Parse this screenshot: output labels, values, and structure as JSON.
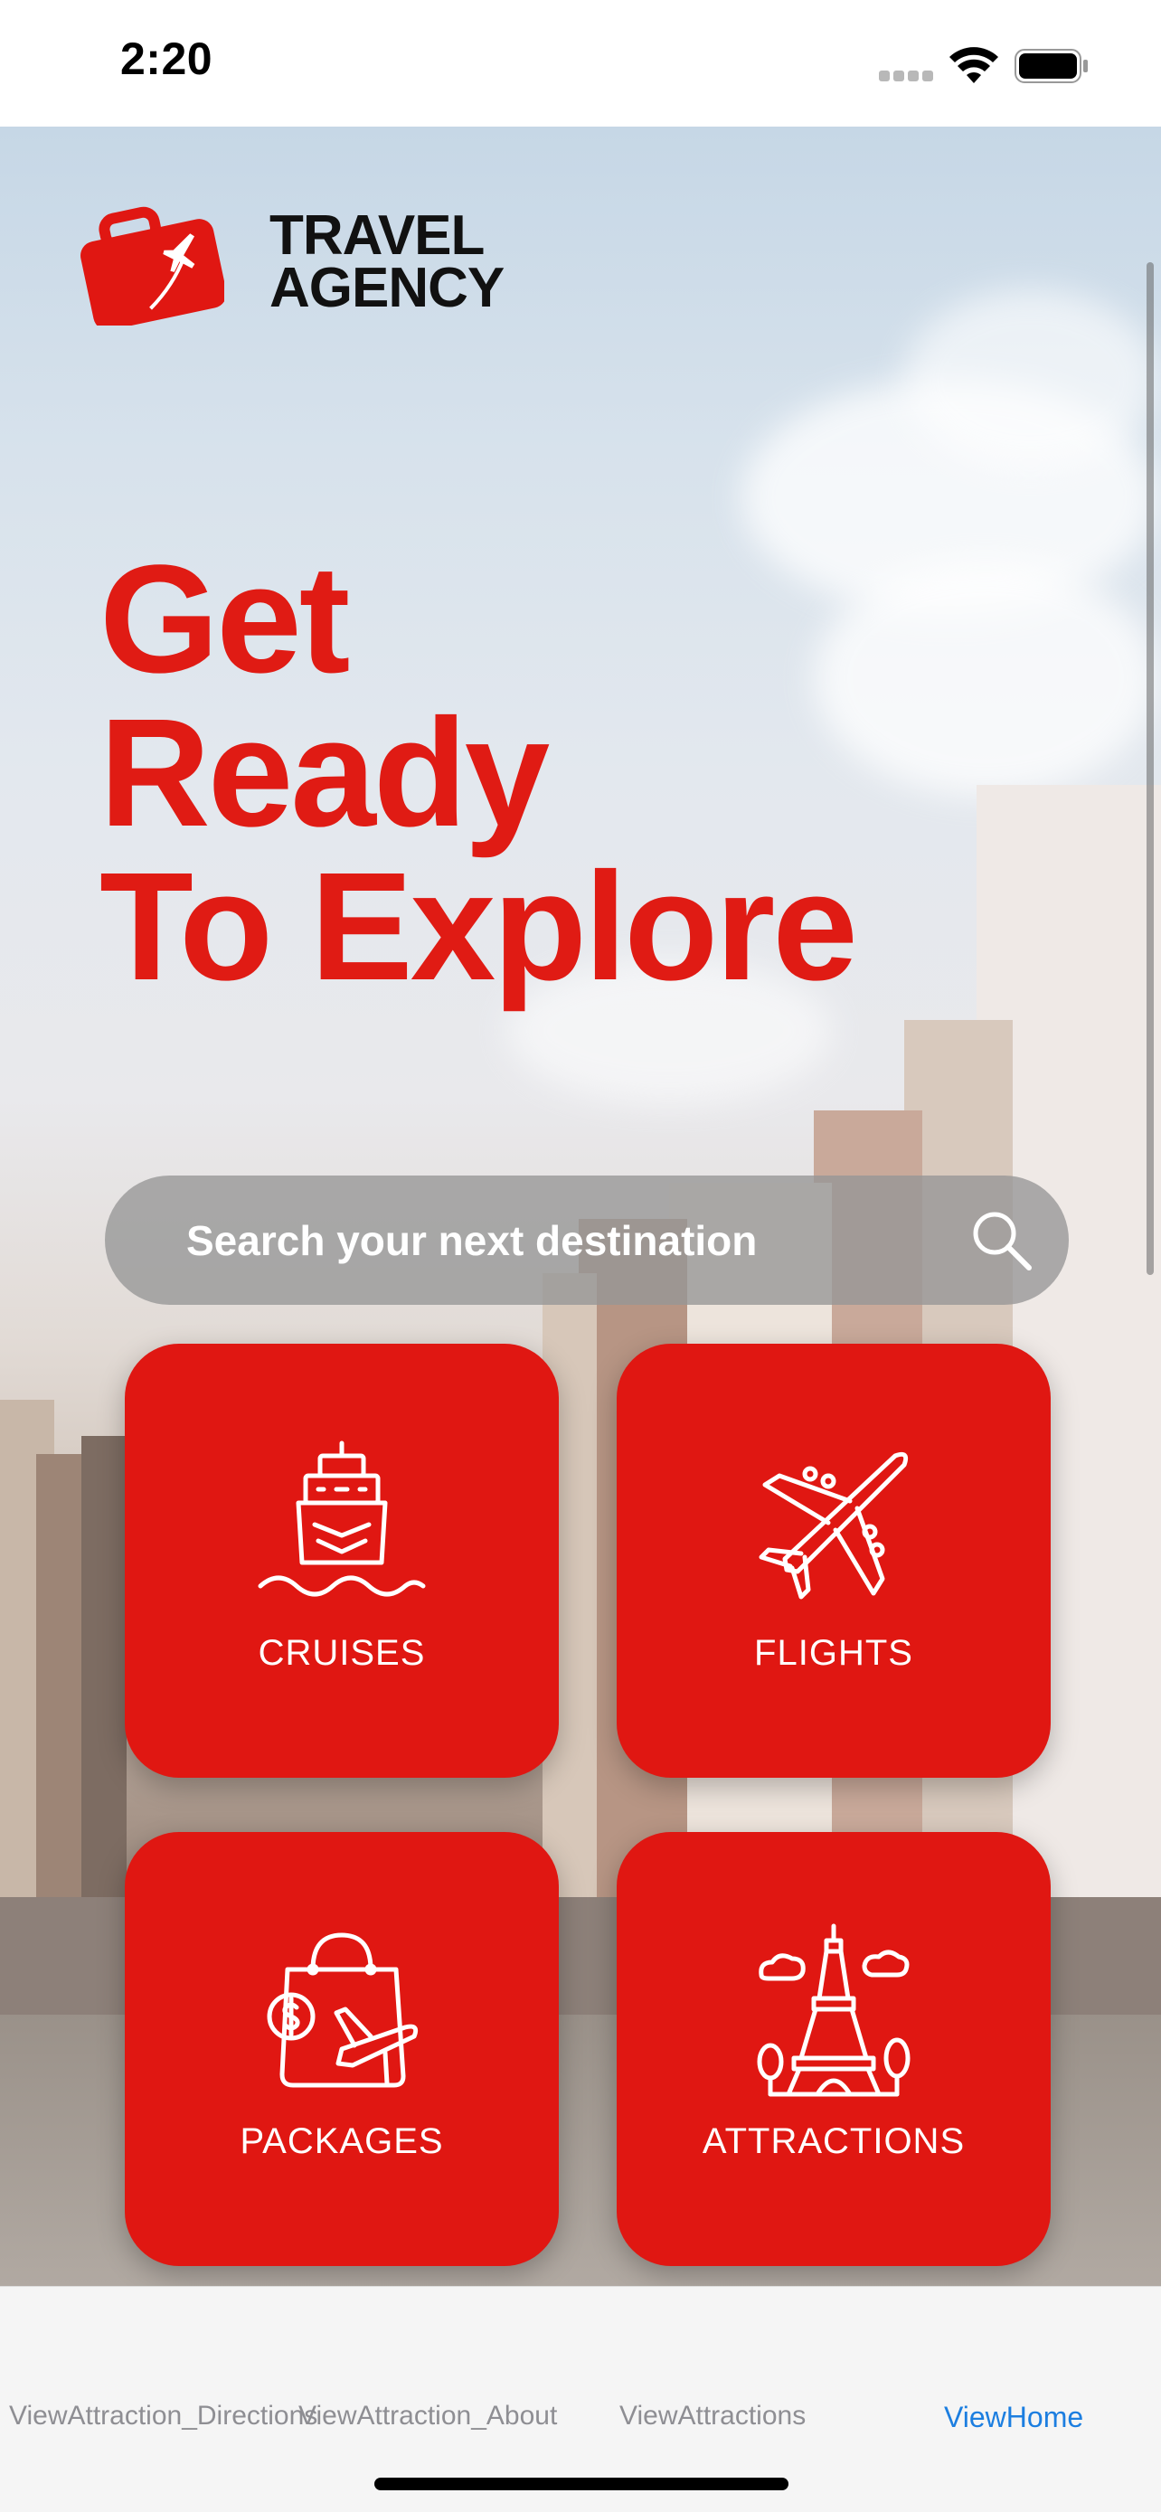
{
  "status_bar": {
    "time": "2:20",
    "icons": [
      "cellular-signal-icon",
      "wifi-icon",
      "battery-icon"
    ]
  },
  "logo": {
    "line1": "TRAVEL",
    "line2": "AGENCY",
    "icon": "suitcase-airplane-icon",
    "color": "#e01712"
  },
  "headline": {
    "line1": "Get",
    "line2": "Ready",
    "line3": "To Explore"
  },
  "search": {
    "placeholder": "Search your next destination",
    "icon": "search-icon"
  },
  "categories": [
    {
      "label": "CRUISES",
      "icon": "cruise-ship-icon"
    },
    {
      "label": "FLIGHTS",
      "icon": "airplane-icon"
    },
    {
      "label": "PACKAGES",
      "icon": "shopping-bag-icon"
    },
    {
      "label": "ATTRACTIONS",
      "icon": "eiffel-tower-icon"
    }
  ],
  "tabbar": {
    "tabs": [
      {
        "label": "ViewAttraction_Directions",
        "active": false
      },
      {
        "label": "ViewAttraction_About",
        "active": false
      },
      {
        "label": "ViewAttractions",
        "active": false
      },
      {
        "label": "ViewHome",
        "active": true
      }
    ]
  },
  "colors": {
    "accent_red": "#e01712",
    "tab_active": "#1c7ee0",
    "tab_inactive": "#8e8e93"
  }
}
